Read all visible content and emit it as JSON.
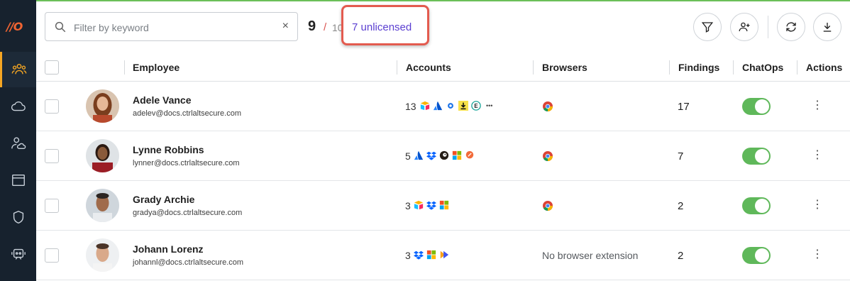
{
  "sidebar": {
    "logo": "//O",
    "items": [
      {
        "icon": "users-icon",
        "active": true
      },
      {
        "icon": "cloud-icon",
        "active": false
      },
      {
        "icon": "user-cloud-icon",
        "active": false
      },
      {
        "icon": "browser-window-icon",
        "active": false
      },
      {
        "icon": "shield-icon",
        "active": false
      },
      {
        "icon": "chat-bot-icon",
        "active": false
      }
    ]
  },
  "toolbar": {
    "search_placeholder": "Filter by keyword",
    "clear_glyph": "×",
    "count_shown": "9",
    "count_separator": "/",
    "count_total": "10",
    "unlicensed_label": "7 unlicensed",
    "buttons": [
      "filter-icon",
      "add-user-icon",
      "refresh-icon",
      "download-icon"
    ]
  },
  "table": {
    "headers": {
      "employee": "Employee",
      "accounts": "Accounts",
      "browsers": "Browsers",
      "findings": "Findings",
      "chatops": "ChatOps",
      "actions": "Actions"
    },
    "rows": [
      {
        "name": "Adele Vance",
        "email": "adelev@docs.ctrlaltsecure.com",
        "accounts": "13",
        "browser": "chrome",
        "browser_text": "",
        "findings": "17",
        "chatops": true
      },
      {
        "name": "Lynne Robbins",
        "email": "lynner@docs.ctrlaltsecure.com",
        "accounts": "5",
        "browser": "chrome",
        "browser_text": "",
        "findings": "7",
        "chatops": true
      },
      {
        "name": "Grady Archie",
        "email": "gradya@docs.ctrlaltsecure.com",
        "accounts": "3",
        "browser": "chrome",
        "browser_text": "",
        "findings": "2",
        "chatops": true
      },
      {
        "name": "Johann Lorenz",
        "email": "johannl@docs.ctrlaltsecure.com",
        "accounts": "3",
        "browser": "none",
        "browser_text": "No browser extension",
        "findings": "2",
        "chatops": true
      }
    ],
    "more_glyph": "•••",
    "kebab_glyph": "⋮"
  },
  "colors": {
    "sidebar_bg": "#17222e",
    "accent_orange": "#f5a623",
    "link_purple": "#5b3fd1",
    "highlight_red": "#e35b4f",
    "toggle_green": "#5fb85a"
  }
}
